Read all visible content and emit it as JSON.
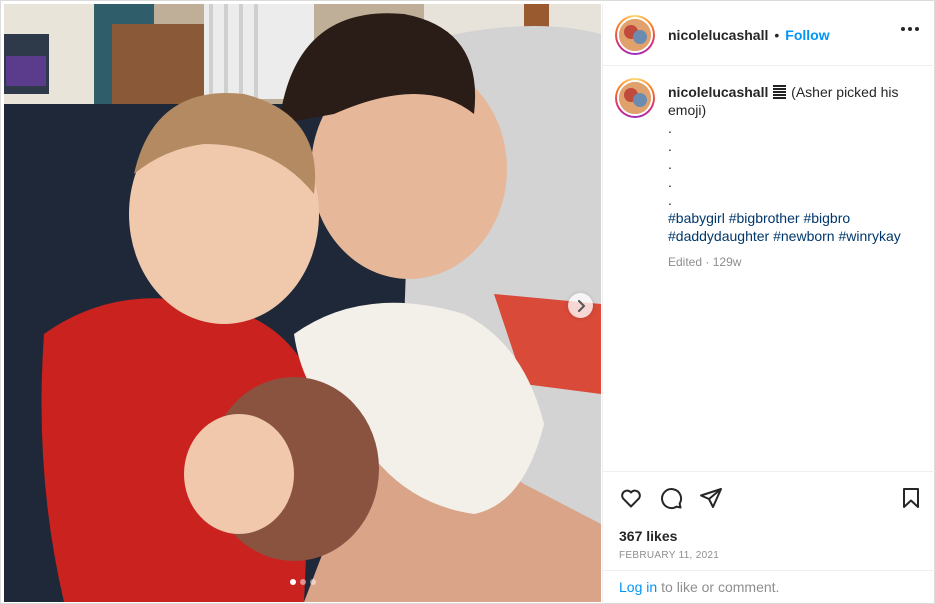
{
  "post": {
    "username": "nicolelucashall",
    "separator": "•",
    "follow_label": "Follow",
    "more_icon": "more-horizontal-icon"
  },
  "caption": {
    "username": "nicolelucashall",
    "emoji": "bar-chart-emoji",
    "text": "(Asher picked his emoji)",
    "dot_lines": [
      ".",
      ".",
      ".",
      ".",
      "."
    ],
    "hashtags": [
      "#babygirl",
      "#bigbrother",
      "#bigbro",
      "#daddydaughter",
      "#newborn",
      "#winrykay"
    ],
    "edited_label": "Edited",
    "meta_separator": "·",
    "age": "129w"
  },
  "actions": {
    "like_icon": "heart-icon",
    "comment_icon": "comment-icon",
    "share_icon": "paper-plane-icon",
    "save_icon": "bookmark-icon"
  },
  "stats": {
    "likes": "367 likes",
    "date": "FEBRUARY 11, 2021"
  },
  "comment_prompt": {
    "login_link": "Log in",
    "rest": "to like or comment."
  },
  "carousel": {
    "slide_count": 3,
    "active_index": 0,
    "next_icon": "chevron-right-icon"
  }
}
